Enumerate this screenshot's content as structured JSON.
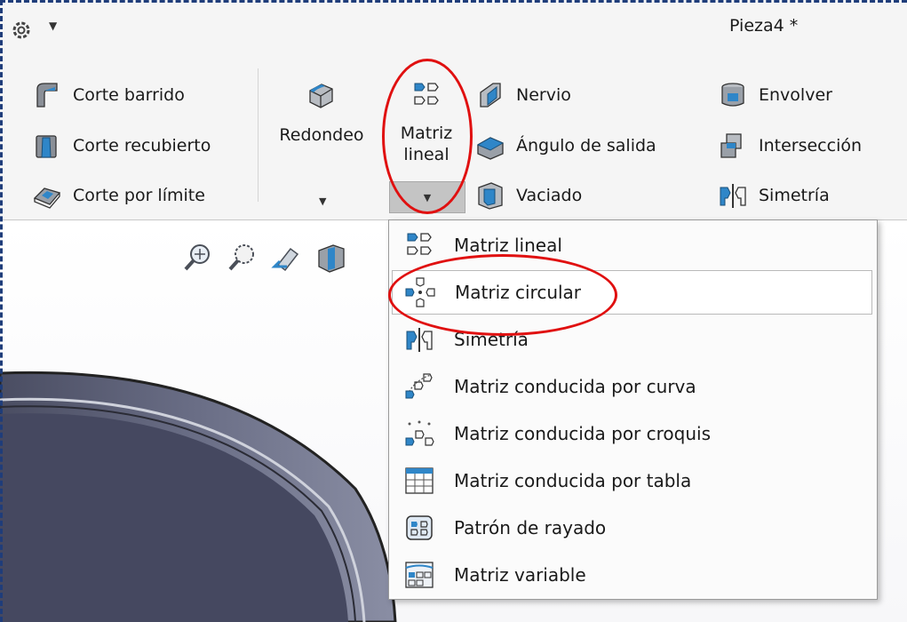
{
  "titlebar": {
    "document_title": "Pieza4 *",
    "options_icon": "gear-icon"
  },
  "ribbon": {
    "cut_group": [
      {
        "label": "Corte barrido",
        "icon": "swept-cut-icon"
      },
      {
        "label": "Corte recubierto",
        "icon": "lofted-cut-icon"
      },
      {
        "label": "Corte por límite",
        "icon": "boundary-cut-icon"
      }
    ],
    "redondeo": {
      "label": "Redondeo",
      "icon": "fillet-icon"
    },
    "matriz_lineal": {
      "line1": "Matriz",
      "line2": "lineal",
      "icon": "linear-pattern-icon"
    },
    "mid_group": [
      {
        "label": "Nervio",
        "icon": "rib-icon"
      },
      {
        "label": "Ángulo de salida",
        "icon": "draft-icon"
      },
      {
        "label": "Vaciado",
        "icon": "shell-icon"
      }
    ],
    "right_group": [
      {
        "label": "Envolver",
        "icon": "wrap-icon"
      },
      {
        "label": "Intersección",
        "icon": "intersect-icon"
      },
      {
        "label": "Simetría",
        "icon": "mirror-icon"
      }
    ]
  },
  "heads_up_toolbar": [
    "zoom-to-fit-icon",
    "zoom-to-area-icon",
    "previous-view-icon",
    "section-view-icon"
  ],
  "dropdown_menu": {
    "items": [
      {
        "label": "Matriz lineal",
        "icon": "linear-pattern-icon"
      },
      {
        "label": "Matriz circular",
        "icon": "circular-pattern-icon",
        "highlighted": true
      },
      {
        "label": "Simetría",
        "icon": "mirror-icon"
      },
      {
        "label": "Matriz conducida por curva",
        "icon": "curve-driven-pattern-icon"
      },
      {
        "label": "Matriz conducida por croquis",
        "icon": "sketch-driven-pattern-icon"
      },
      {
        "label": "Matriz conducida por tabla",
        "icon": "table-driven-pattern-icon"
      },
      {
        "label": "Patrón de rayado",
        "icon": "fill-pattern-icon"
      },
      {
        "label": "Matriz variable",
        "icon": "variable-pattern-icon"
      }
    ]
  },
  "colors": {
    "accent_blue": "#1f6fb0",
    "annotation_red": "#e01010",
    "frame_dashed": "#1f3d7a"
  }
}
